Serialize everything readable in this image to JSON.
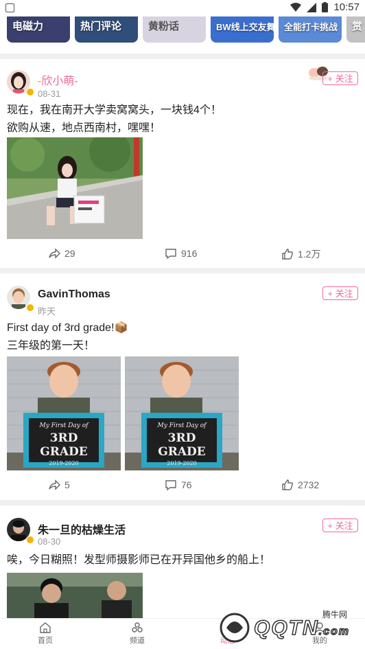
{
  "status_bar": {
    "time": "10:57"
  },
  "banner": {
    "tiles": [
      {
        "label": "电磁力",
        "color": "#3b3f6e"
      },
      {
        "label": "热门评论",
        "color": "#2f4e7a"
      },
      {
        "label": "黄粉话",
        "color": "#d8d3e0"
      },
      {
        "label": "BW线上交友舞台",
        "color": "#3a6fd0"
      },
      {
        "label": "全能打卡挑战",
        "color": "#5b8ad6"
      },
      {
        "label": "赏",
        "color": "#c2c2c2"
      }
    ]
  },
  "posts": [
    {
      "user": "-欣小萌-",
      "date": "08-31",
      "follow": "+ 关注",
      "text": [
        "现在，我在南开大学卖窝窝头，一块钱4个！",
        "欲购从速，地点西南村，嘿嘿！"
      ],
      "shares": "29",
      "comments": "916",
      "likes": "1.2万"
    },
    {
      "user": "GavinThomas",
      "date": "昨天",
      "follow": "+ 关注",
      "text": [
        "First day of 3rd grade!📦",
        "三年级的第一天！"
      ],
      "sign_text": {
        "top": "My First Day of",
        "main": "3RD GRADE",
        "year": "2019-2020"
      },
      "shares": "5",
      "comments": "76",
      "likes": "2732"
    },
    {
      "user": "朱一旦的枯燥生活",
      "date": "08-30",
      "follow": "+ 关注",
      "text": [
        "唉，今日糊照！发型师摄影师已在开异国他乡的船上！"
      ]
    }
  ],
  "bottom_nav": {
    "items": [
      {
        "label": "首页",
        "icon": "home-icon"
      },
      {
        "label": "频道",
        "icon": "channel-icon"
      },
      {
        "label": "动态",
        "icon": "dynamic-icon"
      },
      {
        "label": "我的",
        "icon": "profile-icon"
      }
    ],
    "active": "动态"
  },
  "watermark": {
    "text": "QQTN",
    "sub": "腾牛网",
    "domain": ".com"
  }
}
